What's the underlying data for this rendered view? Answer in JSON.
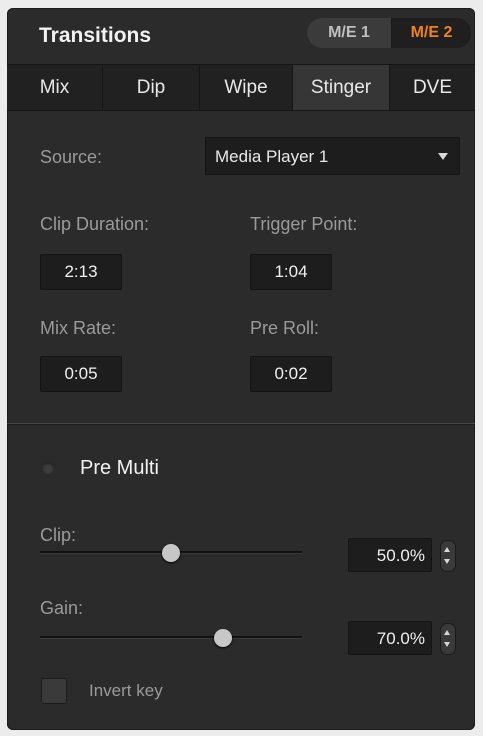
{
  "header": {
    "title": "Transitions",
    "me_buttons": [
      {
        "label": "M/E 1",
        "active": false
      },
      {
        "label": "M/E 2",
        "active": true
      }
    ],
    "accent_color": "#f0831e"
  },
  "tabs": [
    {
      "label": "Mix",
      "active": false
    },
    {
      "label": "Dip",
      "active": false
    },
    {
      "label": "Wipe",
      "active": false
    },
    {
      "label": "Stinger",
      "active": true
    },
    {
      "label": "DVE",
      "active": false
    }
  ],
  "stinger": {
    "source_label": "Source:",
    "source_value": "Media Player 1",
    "clip_duration_label": "Clip Duration:",
    "clip_duration_value": "2:13",
    "trigger_point_label": "Trigger Point:",
    "trigger_point_value": "1:04",
    "mix_rate_label": "Mix Rate:",
    "mix_rate_value": "0:05",
    "pre_roll_label": "Pre Roll:",
    "pre_roll_value": "0:02"
  },
  "key": {
    "pre_multi_label": "Pre Multi",
    "pre_multi_on": false,
    "clip_label": "Clip:",
    "clip_value": "50.0%",
    "clip_fraction": 0.5,
    "gain_label": "Gain:",
    "gain_value": "70.0%",
    "gain_fraction": 0.7,
    "invert_key_label": "Invert key",
    "invert_key_checked": false
  }
}
